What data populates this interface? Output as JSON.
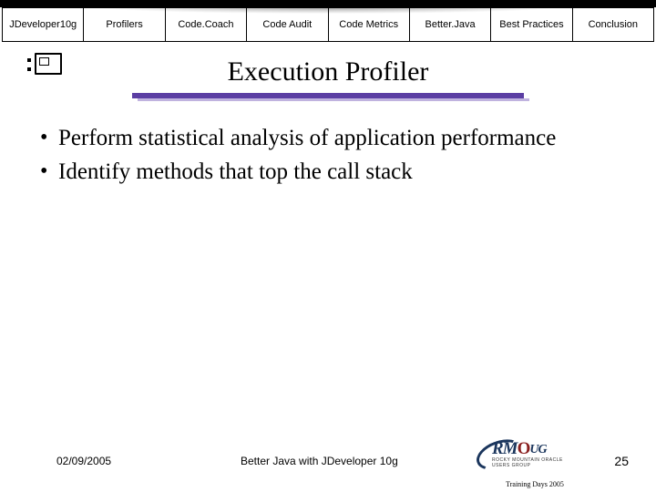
{
  "tabs": {
    "t0": "JDeveloper10g",
    "t1": "Profilers",
    "t2": "Code.Coach",
    "t3": "Code Audit",
    "t4": "Code Metrics",
    "t5": "Better.Java",
    "t6": "Best Practices",
    "t7": "Conclusion"
  },
  "slide": {
    "title": "Execution Profiler",
    "bullets": {
      "b0": "Perform statistical analysis of application performance",
      "b1": "Identify methods that top the call stack"
    }
  },
  "footer": {
    "date": "02/09/2005",
    "title": "Better Java with JDeveloper 10g",
    "page": "25"
  },
  "logo": {
    "main_rm": "RM",
    "main_o": "O",
    "main_ug": "UG",
    "sub1": "ROCKY MOUNTAIN ORACLE USERS GROUP",
    "sub2": "Training Days 2005"
  }
}
